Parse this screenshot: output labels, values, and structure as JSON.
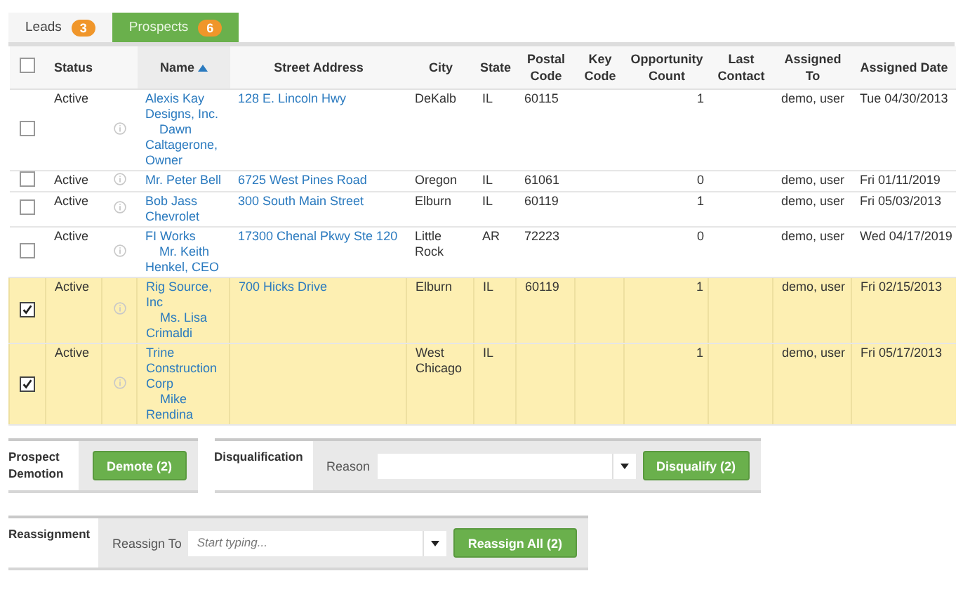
{
  "tabs": [
    {
      "label": "Leads",
      "count": "3",
      "selected": false
    },
    {
      "label": "Prospects",
      "count": "6",
      "selected": true
    }
  ],
  "table": {
    "select_all": {
      "checked": false
    },
    "columns": [
      {
        "label": "Status",
        "sorted": false
      },
      {
        "label": "Name",
        "sorted": true
      },
      {
        "label": "Street Address",
        "sorted": false
      },
      {
        "label": "City",
        "sorted": false
      },
      {
        "label": "State",
        "sorted": false
      },
      {
        "label": "Postal Code",
        "sorted": false
      },
      {
        "label": "Key Code",
        "sorted": false
      },
      {
        "label": "Opportunity Count",
        "sorted": false
      },
      {
        "label": "Last Contact",
        "sorted": false
      },
      {
        "label": "Assigned To",
        "sorted": false
      },
      {
        "label": "Assigned Date",
        "sorted": false
      }
    ],
    "rows": [
      {
        "selected": false,
        "status": "Active",
        "name": "Alexis Kay Designs, Inc.",
        "contact": "Dawn Caltagerone, Owner",
        "street": "128 E. Lincoln Hwy",
        "city": "DeKalb",
        "state": "IL",
        "postal_code": "60115",
        "opportunity_count": "1",
        "assigned_to": "demo, user",
        "assigned_date": "Tue 04/30/2013"
      },
      {
        "selected": false,
        "status": "Active",
        "name": "Mr. Peter Bell",
        "street": "6725 West Pines Road",
        "city": "Oregon",
        "state": "IL",
        "postal_code": "61061",
        "opportunity_count": "0",
        "assigned_to": "demo, user",
        "assigned_date": "Fri 01/11/2019"
      },
      {
        "selected": false,
        "status": "Active",
        "name": "Bob Jass Chevrolet",
        "street": "300 South Main Street",
        "city": "Elburn",
        "state": "IL",
        "postal_code": "60119",
        "opportunity_count": "1",
        "assigned_to": "demo, user",
        "assigned_date": "Fri 05/03/2013"
      },
      {
        "selected": false,
        "status": "Active",
        "name": "FI Works",
        "contact": "Mr. Keith Henkel, CEO",
        "street": "17300 Chenal Pkwy Ste 120",
        "city": "Little Rock",
        "state": "AR",
        "postal_code": "72223",
        "opportunity_count": "0",
        "assigned_to": "demo, user",
        "assigned_date": "Wed 04/17/2019"
      },
      {
        "selected": true,
        "status": "Active",
        "name": "Rig Source, Inc",
        "contact": "Ms. Lisa Crimaldi",
        "street": "700 Hicks Drive",
        "city": "Elburn",
        "state": "IL",
        "postal_code": "60119",
        "opportunity_count": "1",
        "assigned_to": "demo, user",
        "assigned_date": "Fri 02/15/2013"
      },
      {
        "selected": true,
        "status": "Active",
        "name": "Trine Construction Corp",
        "contact": "Mike Rendina",
        "city": "West Chicago",
        "state": "IL",
        "opportunity_count": "1",
        "assigned_to": "demo, user",
        "assigned_date": "Fri 05/17/2013"
      }
    ]
  },
  "demotion": {
    "title": "Prospect Demotion",
    "button": "Demote (2)"
  },
  "disqualification": {
    "title": "Disqualification",
    "field_label": "Reason",
    "button": "Disqualify (2)"
  },
  "reassignment": {
    "title": "Reassignment",
    "field_label": "Reassign To",
    "placeholder": "Start typing...",
    "button": "Reassign All (2)"
  }
}
